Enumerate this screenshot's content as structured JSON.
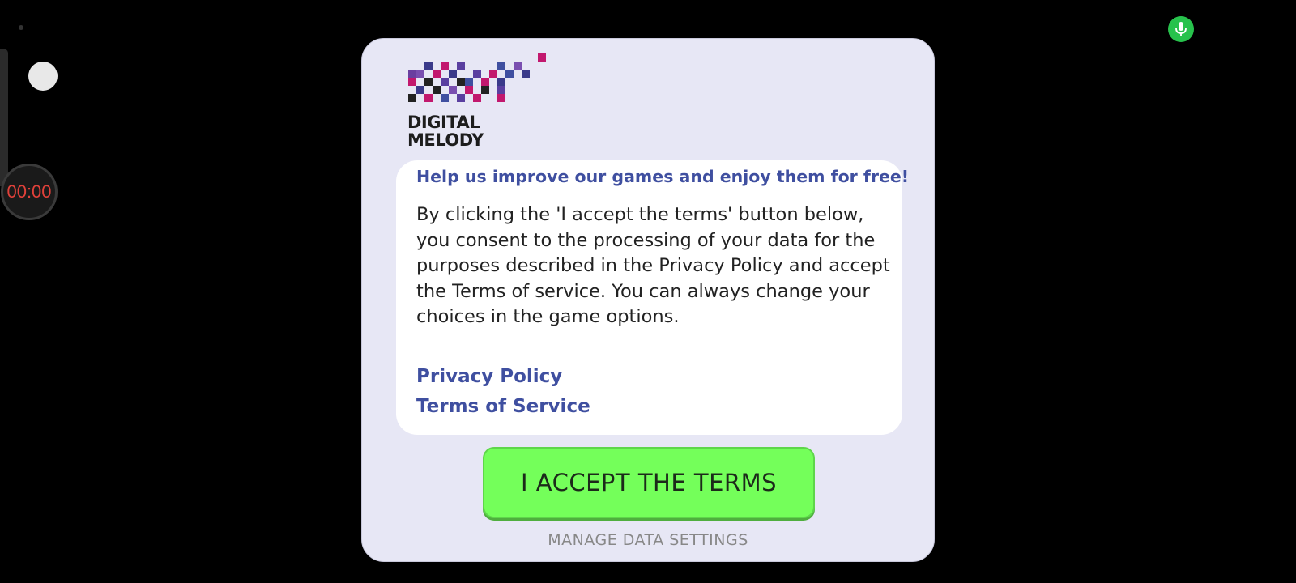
{
  "overlay": {
    "timer_text": "00:00"
  },
  "dialog": {
    "logo_line1": "DIGITAL",
    "logo_line2": "MELODY",
    "headline": "Help us improve our games and enjoy them for free!",
    "body": "By clicking the 'I accept the terms' button below, you consent to the processing of your data for the purposes described in the Privacy Policy and accept the Terms of service. You can always change your choices in the game options.",
    "privacy_link": "Privacy Policy",
    "terms_link": "Terms of Service",
    "accept_button": "I ACCEPT THE TERMS",
    "manage_link": "MANAGE DATA SETTINGS"
  },
  "colors": {
    "accent": "#3f4fa0",
    "accept_button": "#74ff5a",
    "dialog_bg": "#e7e7f5",
    "mic_indicator": "#27c24c",
    "timer_text": "#e0413a"
  },
  "icons": {
    "mic": "microphone-icon",
    "logo": "pixel-grid-logo"
  }
}
